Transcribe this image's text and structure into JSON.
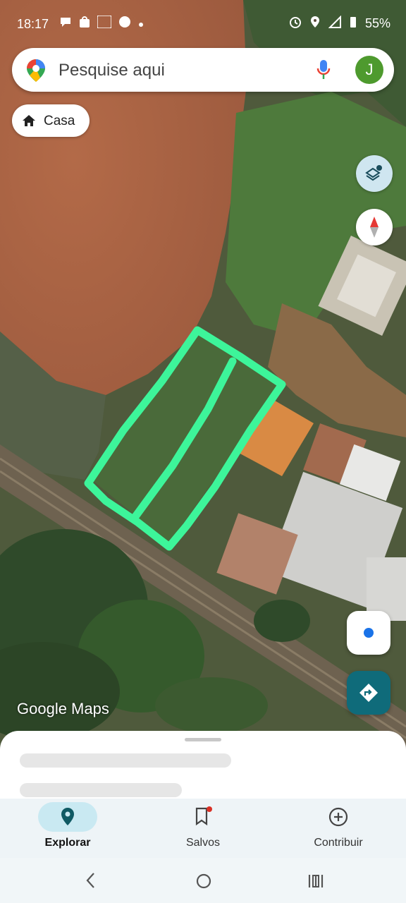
{
  "status_bar": {
    "time": "18:17",
    "battery": "55%",
    "notification_icons": [
      "chat-bubble-icon",
      "shopee-icon",
      "temu-icon",
      "app-icon",
      "more-dot-icon"
    ],
    "system_icons": [
      "alarm-icon",
      "location-icon",
      "signal-icon",
      "battery-icon"
    ]
  },
  "search": {
    "placeholder": "Pesquise aqui",
    "avatar_initial": "J"
  },
  "chip": {
    "label": "Casa"
  },
  "map": {
    "branding": "Google Maps",
    "overlay_color": "#3df59a"
  },
  "bottom_nav": {
    "items": [
      {
        "label": "Explorar",
        "icon": "explore-pin-icon",
        "active": true
      },
      {
        "label": "Salvos",
        "icon": "bookmark-icon",
        "active": false
      },
      {
        "label": "Contribuir",
        "icon": "add-circle-icon",
        "active": false
      }
    ]
  },
  "colors": {
    "accent": "#0f6b7a",
    "active_pill": "#c9e9f2",
    "avatar": "#4e9a2e"
  }
}
